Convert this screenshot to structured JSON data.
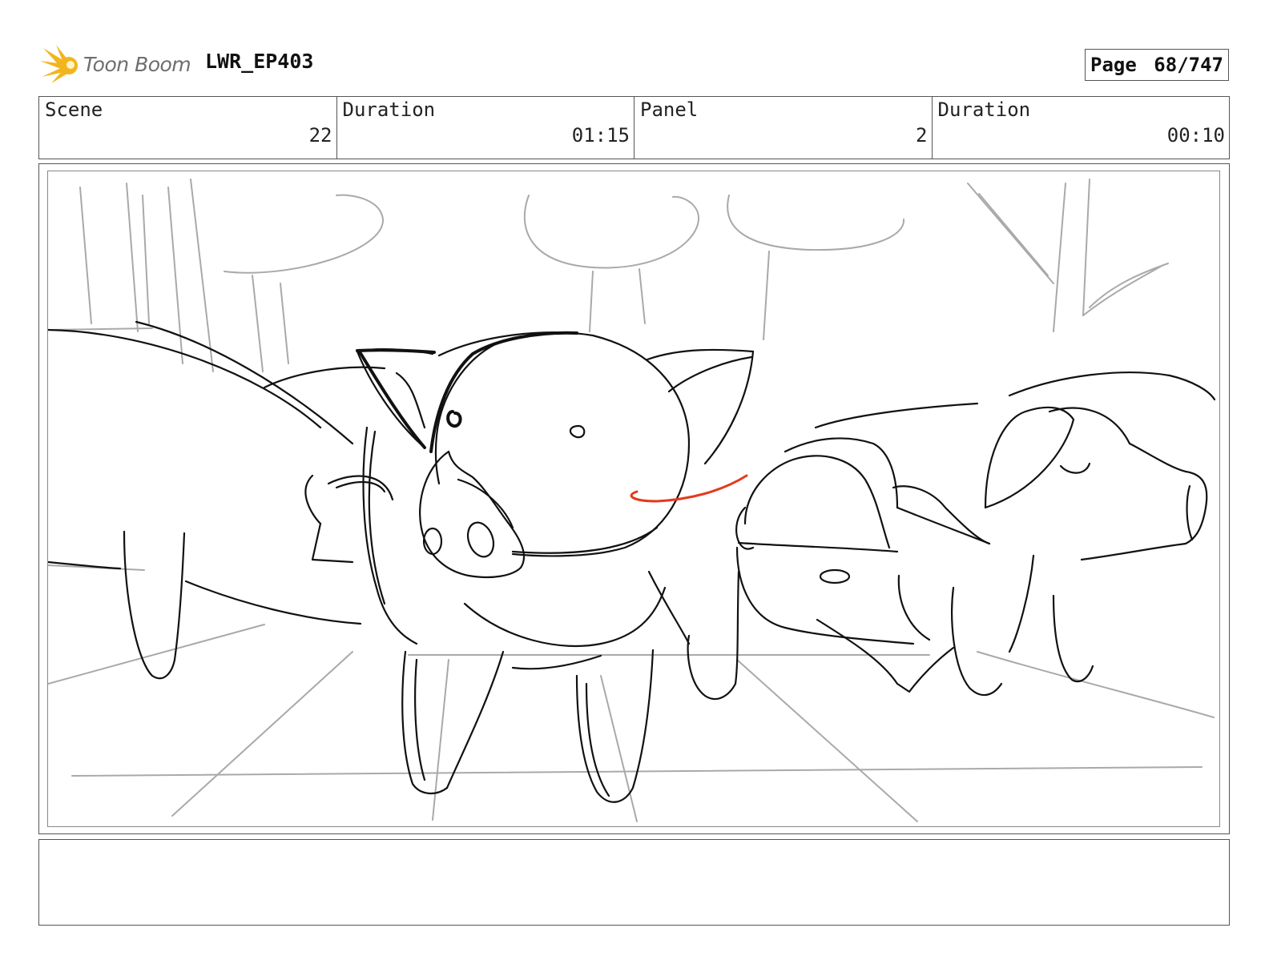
{
  "header": {
    "logo_text": "Toon Boom",
    "project": "LWR_EP403",
    "page_label": "Page",
    "page_value": "68/747"
  },
  "info": {
    "scene_label": "Scene",
    "scene_value": "22",
    "scene_duration_label": "Duration",
    "scene_duration_value": "01:15",
    "panel_label": "Panel",
    "panel_value": "2",
    "panel_duration_label": "Duration",
    "panel_duration_value": "00:10"
  },
  "notes": {
    "text": ""
  },
  "colors": {
    "logo_burst": "#f2b51d",
    "sketch_line": "#111111",
    "construction_line": "#a9a9a9",
    "accent_red": "#e53a1c"
  }
}
